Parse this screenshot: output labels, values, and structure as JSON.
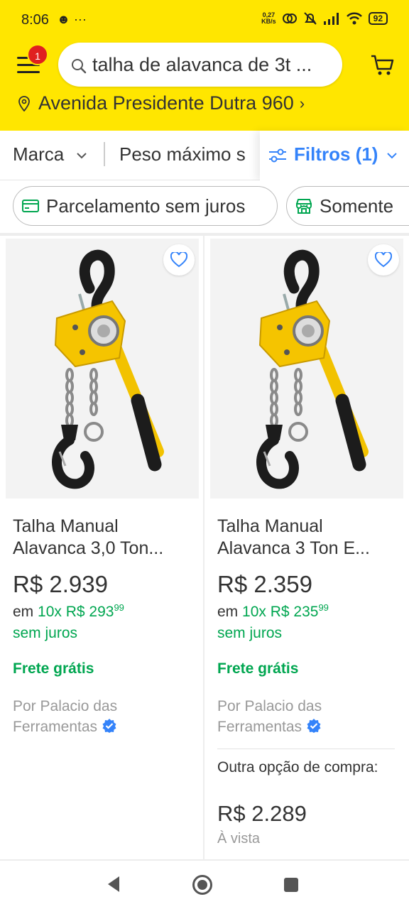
{
  "status_bar": {
    "time": "8:06",
    "left_icons": "☻ ···",
    "net_speed_value": "0,27",
    "net_speed_unit": "KB/s",
    "battery": "92"
  },
  "header": {
    "menu_badge": "1",
    "search_text": "talha de alavanca de 3t ...",
    "address": "Avenida Presidente Dutra 960",
    "address_chevron": "›"
  },
  "filters": {
    "brand": "Marca",
    "max_weight": "Peso máximo s",
    "filtros": "Filtros (1)"
  },
  "chips": [
    {
      "label": "Parcelamento sem juros",
      "icon": "card-icon"
    },
    {
      "label": "Somente",
      "icon": "store-icon"
    }
  ],
  "products": [
    {
      "title_line1": "Talha Manual",
      "title_line2": "Alavanca 3,0 Ton...",
      "price": "R$ 2.939",
      "installment_prefix": "em",
      "installment_main": "10x R$ 293",
      "installment_cents": "99",
      "no_interest": "sem juros",
      "shipping": "Frete grátis",
      "seller_line1": "Por Palacio das",
      "seller_line2": "Ferramentas"
    },
    {
      "title_line1": "Talha Manual",
      "title_line2": "Alavanca 3 Ton E...",
      "price": "R$ 2.359",
      "installment_prefix": "em",
      "installment_main": "10x R$ 235",
      "installment_cents": "99",
      "no_interest": "sem juros",
      "shipping": "Frete grátis",
      "seller_line1": "Por Palacio das",
      "seller_line2": "Ferramentas",
      "other_option": "Outra opção de compra:",
      "other_price": "R$ 2.289",
      "other_note": "À vista"
    }
  ],
  "colors": {
    "header_bg": "#ffe600",
    "accent_blue": "#3483fa",
    "green": "#00a650",
    "badge_red": "#e02020"
  }
}
